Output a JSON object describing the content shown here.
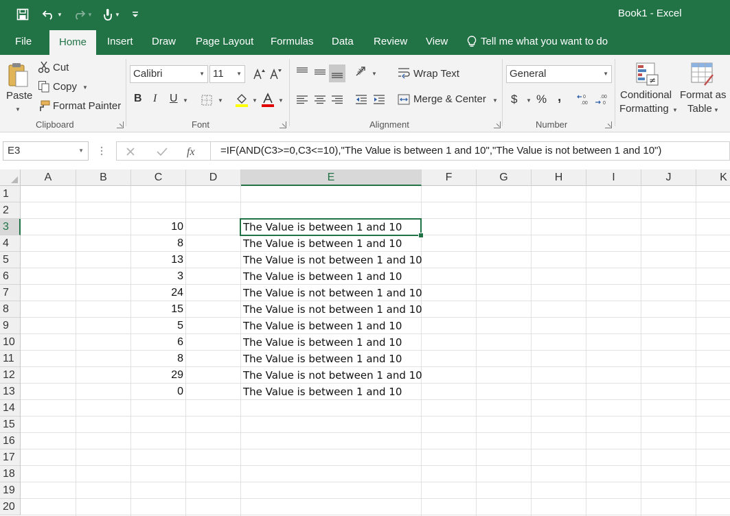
{
  "window": {
    "title": "Book1  -  Excel"
  },
  "tabs": [
    "File",
    "Home",
    "Insert",
    "Draw",
    "Page Layout",
    "Formulas",
    "Data",
    "Review",
    "View"
  ],
  "tell_me": "Tell me what you want to do",
  "clipboard": {
    "paste": "Paste",
    "cut": "Cut",
    "copy": "Copy",
    "format_painter": "Format Painter",
    "label": "Clipboard"
  },
  "font": {
    "name": "Calibri",
    "size": "11",
    "bold": "B",
    "italic": "I",
    "underline": "U",
    "label": "Font"
  },
  "alignment": {
    "wrap_text": "Wrap Text",
    "merge_center": "Merge & Center",
    "label": "Alignment"
  },
  "number": {
    "format": "General",
    "currency": "$",
    "percent": "%",
    "comma": ",",
    "label": "Number"
  },
  "styles": {
    "conditional_line1": "Conditional",
    "conditional_line2": "Formatting",
    "table_line1": "Format as",
    "table_line2": "Table"
  },
  "formula_bar": {
    "name_box": "E3",
    "formula": "=IF(AND(C3>=0,C3<=10),\"The Value is between 1 and 10\",\"The Value is not between 1 and 10\")"
  },
  "sheet": {
    "columns": [
      "A",
      "B",
      "C",
      "D",
      "E",
      "F",
      "G",
      "H",
      "I",
      "J",
      "K"
    ],
    "rows": [
      "1",
      "2",
      "3",
      "4",
      "5",
      "6",
      "7",
      "8",
      "9",
      "10",
      "11",
      "12",
      "13",
      "14",
      "15",
      "16",
      "17",
      "18",
      "19",
      "20"
    ],
    "active_cell": "E3",
    "column_c": [
      "",
      "",
      "10",
      "8",
      "13",
      "3",
      "24",
      "15",
      "5",
      "6",
      "8",
      "29",
      "0"
    ],
    "column_e": [
      "",
      "",
      "The Value is between 1 and 10",
      "The Value is between 1 and 10",
      "The Value is not between 1 and 10",
      "The Value is between 1 and 10",
      "The Value is not between 1 and 10",
      "The Value is not between 1 and 10",
      "The Value is between 1 and 10",
      "The Value is between 1 and 10",
      "The Value is between 1 and 10",
      "The Value is not between 1 and 10",
      "The Value is between 1 and 10"
    ]
  },
  "colors": {
    "accent": "#217346",
    "ribbon": "#f3f3f3"
  }
}
